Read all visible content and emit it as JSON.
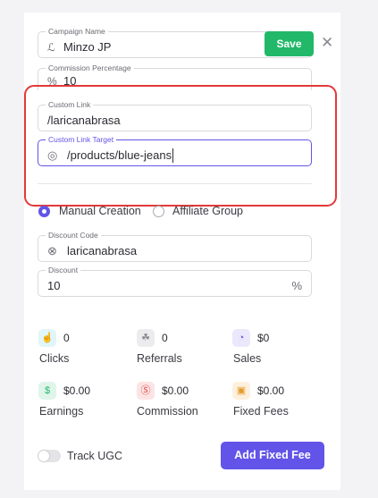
{
  "campaign": {
    "label": "Campaign Name",
    "value": "Minzo JP",
    "icon": "signature-icon"
  },
  "save_label": "Save",
  "close_symbol": "✕",
  "commission": {
    "label": "Commission Percentage",
    "value": "10",
    "icon": "percent-icon"
  },
  "custom_link": {
    "label": "Custom Link",
    "value": "/laricanabrasa"
  },
  "custom_link_target": {
    "label": "Custom Link Target",
    "value": "/products/blue-jeans",
    "icon": "target-icon"
  },
  "creation": {
    "options": [
      "Manual Creation",
      "Affiliate Group"
    ],
    "selected": "Manual Creation"
  },
  "discount_code": {
    "label": "Discount Code",
    "value": "laricanabrasa",
    "icon": "discount-icon"
  },
  "discount": {
    "label": "Discount",
    "value": "10",
    "unit": "%"
  },
  "stats": [
    {
      "value": "0",
      "label": "Clicks",
      "icon": "click-icon",
      "glyph": "☝",
      "color": "#2bb6c9",
      "bg": "#e0f6f8"
    },
    {
      "value": "0",
      "label": "Referrals",
      "icon": "referral-icon",
      "glyph": "☘",
      "color": "#8a8a93",
      "bg": "#ececef"
    },
    {
      "value": "$0",
      "label": "Sales",
      "icon": "pie-chart-icon",
      "glyph": "◔",
      "color": "#6254e8",
      "bg": "#ebe8fc"
    },
    {
      "value": "$0.00",
      "label": "Earnings",
      "icon": "dollar-icon",
      "glyph": "$",
      "color": "#22b869",
      "bg": "#e0f5ea"
    },
    {
      "value": "$0.00",
      "label": "Commission",
      "icon": "coin-icon",
      "glyph": "Ⓢ",
      "color": "#e23a3a",
      "bg": "#fde4e4"
    },
    {
      "value": "$0.00",
      "label": "Fixed Fees",
      "icon": "fee-icon",
      "glyph": "▣",
      "color": "#e59a2b",
      "bg": "#fdf0dd"
    }
  ],
  "track_ugc": {
    "label": "Track UGC",
    "enabled": false
  },
  "add_fixed_fee_label": "Add Fixed Fee",
  "colors": {
    "accent": "#6254e8",
    "save": "#22b869",
    "highlight": "#e23a3a"
  }
}
